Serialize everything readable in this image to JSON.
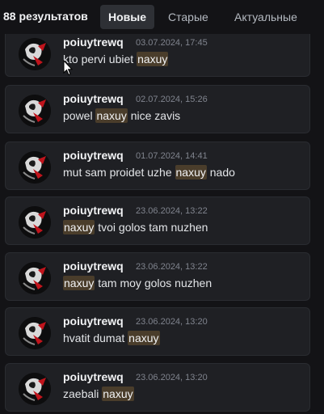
{
  "header": {
    "results_count": "88 результатов",
    "tabs": [
      {
        "label": "Новые",
        "active": true
      },
      {
        "label": "Старые",
        "active": false
      },
      {
        "label": "Актуальные",
        "active": false
      }
    ]
  },
  "results": [
    {
      "author": "poiuytrewq",
      "timestamp": "03.07.2024, 17:45",
      "before": "kto pervi ubiet ",
      "highlight": "naxuy",
      "after": ""
    },
    {
      "author": "poiuytrewq",
      "timestamp": "02.07.2024, 15:26",
      "before": "powel ",
      "highlight": "naxuy",
      "after": " nice zavis"
    },
    {
      "author": "poiuytrewq",
      "timestamp": "01.07.2024, 14:41",
      "before": "mut sam proidet uzhe ",
      "highlight": "naxuy",
      "after": " nado"
    },
    {
      "author": "poiuytrewq",
      "timestamp": "23.06.2024, 13:22",
      "before": "",
      "highlight": "naxuy",
      "after": " tvoi golos tam nuzhen"
    },
    {
      "author": "poiuytrewq",
      "timestamp": "23.06.2024, 13:22",
      "before": "",
      "highlight": "naxuy",
      "after": " tam moy golos nuzhen"
    },
    {
      "author": "poiuytrewq",
      "timestamp": "23.06.2024, 13:20",
      "before": "hvatit dumat ",
      "highlight": "naxuy",
      "after": ""
    },
    {
      "author": "poiuytrewq",
      "timestamp": "23.06.2024, 13:20",
      "before": "zaebali ",
      "highlight": "naxuy",
      "after": ""
    }
  ],
  "colors": {
    "highlight_bg": "#4a3d2b",
    "accent_red": "#c0141c"
  }
}
